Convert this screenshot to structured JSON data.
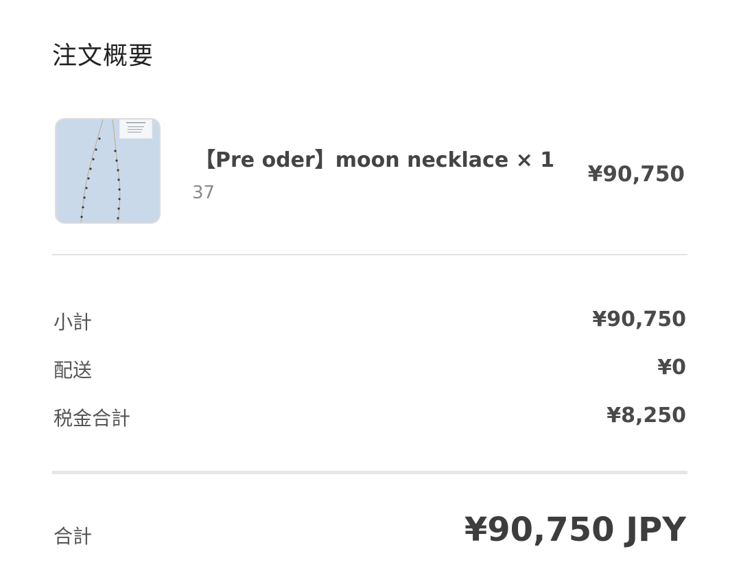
{
  "summary": {
    "title": "注文概要"
  },
  "line_items": [
    {
      "image": "necklace-photo",
      "name": "【Pre oder】moon necklace × 1",
      "variant": "37",
      "price": "¥90,750"
    }
  ],
  "totals": {
    "subtotal_label": "小計",
    "subtotal_value": "¥90,750",
    "shipping_label": "配送",
    "shipping_value": "¥0",
    "tax_label": "税金合計",
    "tax_value": "¥8,250",
    "total_label": "合計",
    "total_value": "¥90,750 JPY"
  }
}
